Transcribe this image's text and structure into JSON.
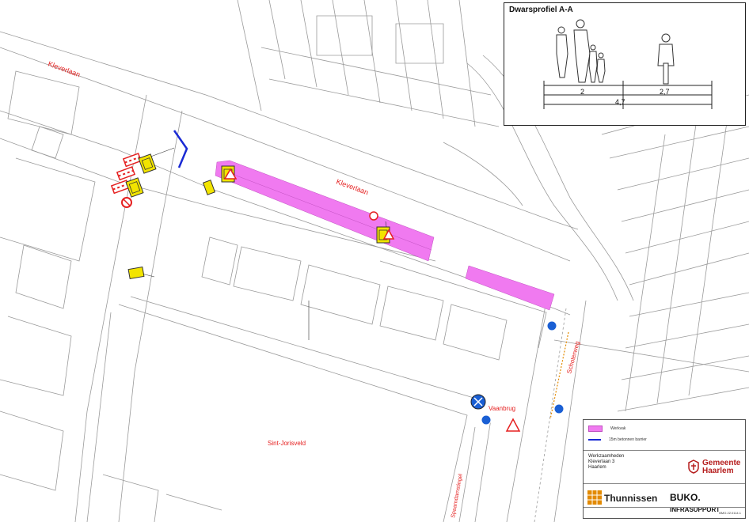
{
  "map": {
    "street_labels": [
      {
        "text": "Kleverlaan",
        "id": "kleverlaan-west"
      },
      {
        "text": "Kleverlaan",
        "id": "kleverlaan-center"
      },
      {
        "text": "Schoterweg",
        "id": "schoterweg"
      },
      {
        "text": "Vaanbrug",
        "id": "vaanbrug"
      },
      {
        "text": "Sint-Jorisveld",
        "id": "sint-jorisveld"
      },
      {
        "text": "Spaarndamstingel",
        "id": "spaarndamstingel"
      }
    ],
    "colors": {
      "work_area": "#f07af0",
      "label_red": "#e52020",
      "barrier_blue": "#1a2ad4",
      "sign_yellow": "#f2e400",
      "line_gray": "#9a9a9a"
    }
  },
  "profile": {
    "title": "Dwarsprofiel A-A",
    "dims": {
      "left": "2",
      "right": "2,7",
      "total": "4,7"
    }
  },
  "titleblock": {
    "legend": [
      {
        "label": "Werkvak",
        "color": "#f07af0"
      },
      {
        "label": "15m betonnen barrier",
        "color": "#1a2ad4"
      }
    ],
    "project": [
      "Werkzaamheden",
      "Kleverlaan 3",
      "Haarlem"
    ],
    "gemeente": [
      "Gemeente",
      "Haarlem"
    ],
    "thunnissen": "Thunnissen",
    "buko": "BUKO.",
    "buko_sub": "INFRASUPPORT",
    "drawing_code": "BMO.22.0114.1"
  }
}
